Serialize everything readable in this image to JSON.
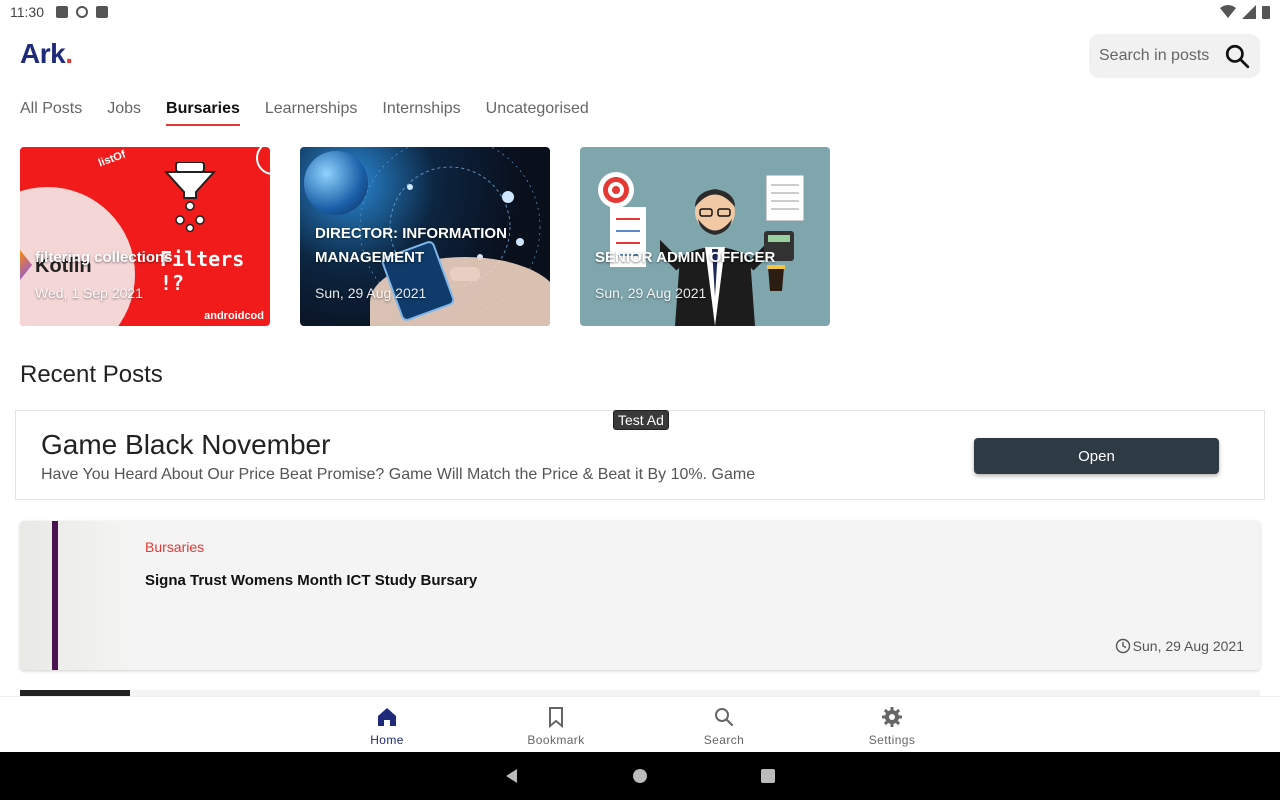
{
  "status_bar": {
    "time": "11:30"
  },
  "app": {
    "logo_text": "Ark",
    "logo_dot": "."
  },
  "search": {
    "placeholder": "Search in posts"
  },
  "tabs": [
    {
      "label": "All Posts",
      "active": false
    },
    {
      "label": "Jobs",
      "active": false
    },
    {
      "label": "Bursaries",
      "active": true
    },
    {
      "label": "Learnerships",
      "active": false
    },
    {
      "label": "Internships",
      "active": false
    },
    {
      "label": "Uncategorised",
      "active": false
    }
  ],
  "featured": [
    {
      "title": "filtering collections",
      "date": "Wed, 1 Sep 2021",
      "image_text": {
        "main": "Filters !?",
        "logo": "Kotlin",
        "top": "listOf",
        "brand": "androidcod"
      }
    },
    {
      "title": "DIRECTOR: INFORMATION MANAGEMENT",
      "date": "Sun, 29 Aug 2021"
    },
    {
      "title": "SENIOR ADMIN OFFICER",
      "date": "Sun, 29 Aug 2021"
    }
  ],
  "recent": {
    "title": "Recent Posts",
    "ad": {
      "label": "Test Ad",
      "title": "Game Black November",
      "description": "Have You Heard About Our Price Beat Promise? Game Will Match the Price & Beat it By 10%. Game",
      "button": "Open"
    },
    "posts": [
      {
        "category": "Bursaries",
        "title": "Signa Trust Womens Month ICT Study Bursary",
        "date": "Sun, 29 Aug 2021"
      }
    ]
  },
  "bottom_nav": [
    {
      "label": "Home",
      "icon": "home-icon",
      "active": true
    },
    {
      "label": "Bookmark",
      "icon": "bookmark-icon",
      "active": false
    },
    {
      "label": "Search",
      "icon": "search-icon",
      "active": false
    },
    {
      "label": "Settings",
      "icon": "gear-icon",
      "active": false
    }
  ],
  "colors": {
    "brand": "#1f2a7a",
    "accent": "#e53935",
    "ad_button": "#2e3b44"
  }
}
